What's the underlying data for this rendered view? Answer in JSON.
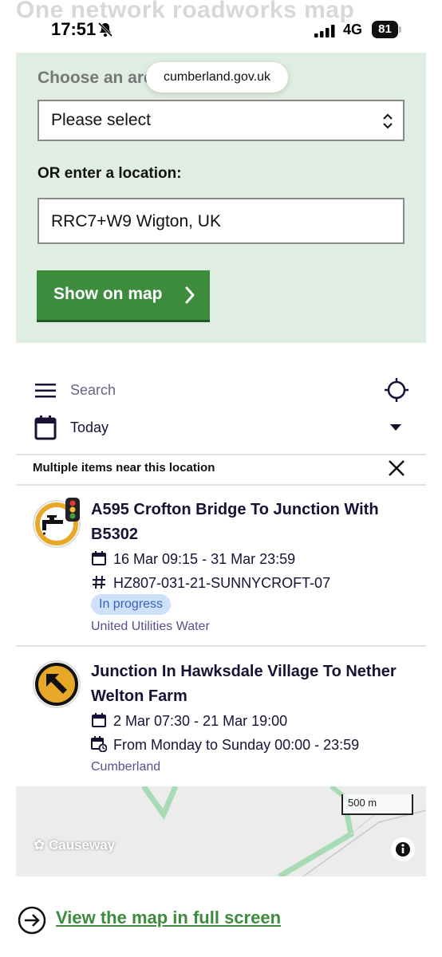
{
  "page_title_behind": "One network roadworks map",
  "status_bar": {
    "time": "17:51",
    "network": "4G",
    "battery": "81"
  },
  "browser": {
    "url": "cumberland.gov.uk"
  },
  "form": {
    "choose_label": "Choose an are",
    "select_value": "Please select",
    "or_label": "OR enter a location:",
    "location_value": "RRC7+W9 Wigton, UK",
    "show_button": "Show on map"
  },
  "toolbar": {
    "search_placeholder": "Search",
    "date_filter": "Today"
  },
  "results": {
    "heading": "Multiple items near this location",
    "items": [
      {
        "title": "A595 Crofton Bridge To Junction With B5302",
        "dates": "16 Mar 09:15 - 31 Mar 23:59",
        "reference": "HZ807-031-21-SUNNYCROFT-07",
        "status": "In progress",
        "owner": "United Utilities Water",
        "icon": "water-roadworks-traffic-light-icon"
      },
      {
        "title": "Junction In Hawksdale Village To Nether Welton Farm",
        "dates": "2 Mar 07:30 - 21 Mar 19:00",
        "schedule": "From Monday to Sunday 00:00 - 23:59",
        "owner": "Cumberland",
        "icon": "diversion-arrow-icon"
      }
    ]
  },
  "map": {
    "scale_label": "500 m",
    "attribution": "Causeway"
  },
  "footer": {
    "full_screen_link": "View the map in full screen"
  },
  "colors": {
    "brand_green": "#3d8b3d",
    "panel_bg": "#dfede2",
    "badge_bg": "#cfe0fb",
    "owner_text": "#5a4e8c",
    "icon_amber": "#e8a827"
  }
}
